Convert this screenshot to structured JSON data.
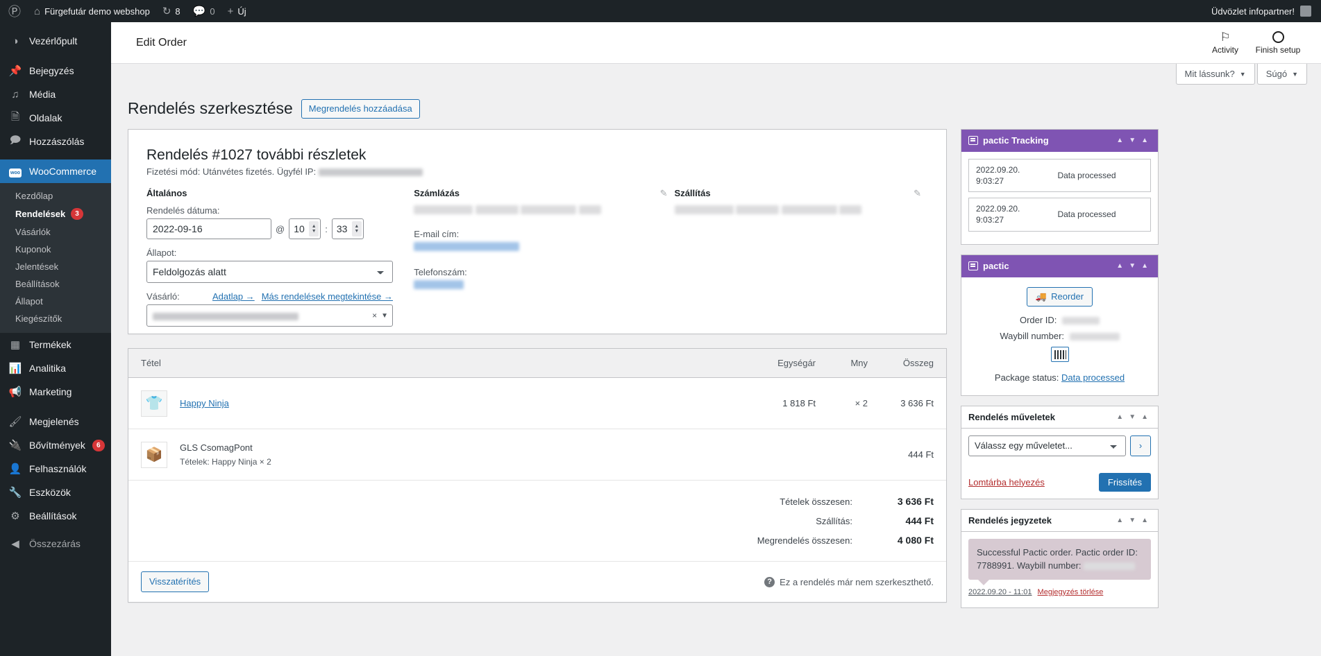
{
  "adminbar": {
    "site_title": "Fürgefutár demo webshop",
    "updates_count": "8",
    "comments_count": "0",
    "new_label": "Új",
    "greeting": "Üdvözlet infopartner!"
  },
  "sidebar": {
    "items": [
      {
        "label": "Vezérlőpult",
        "icon": "dashboard-icon"
      },
      {
        "label": "Bejegyzés",
        "icon": "pin-icon"
      },
      {
        "label": "Média",
        "icon": "media-icon"
      },
      {
        "label": "Oldalak",
        "icon": "pages-icon"
      },
      {
        "label": "Hozzászólás",
        "icon": "comment-icon"
      },
      {
        "label": "WooCommerce",
        "icon": "woocommerce-icon",
        "current": true
      },
      {
        "label": "Termékek",
        "icon": "products-icon"
      },
      {
        "label": "Analitika",
        "icon": "analytics-icon"
      },
      {
        "label": "Marketing",
        "icon": "megaphone-icon"
      },
      {
        "label": "Megjelenés",
        "icon": "appearance-icon"
      },
      {
        "label": "Bővítmények",
        "icon": "plugin-icon",
        "badge": "6"
      },
      {
        "label": "Felhasználók",
        "icon": "users-icon"
      },
      {
        "label": "Eszközök",
        "icon": "tools-icon"
      },
      {
        "label": "Beállítások",
        "icon": "settings-icon"
      },
      {
        "label": "Összezárás",
        "icon": "collapse-icon"
      }
    ],
    "submenu": [
      {
        "label": "Kezdőlap"
      },
      {
        "label": "Rendelések",
        "badge": "3",
        "active": true
      },
      {
        "label": "Vásárlók"
      },
      {
        "label": "Kuponok"
      },
      {
        "label": "Jelentések"
      },
      {
        "label": "Beállítások"
      },
      {
        "label": "Állapot"
      },
      {
        "label": "Kiegészítők"
      }
    ]
  },
  "wc_header": {
    "title": "Edit Order",
    "activity_label": "Activity",
    "finish_setup_label": "Finish setup"
  },
  "screen_meta": {
    "options_label": "Mit lássunk?",
    "help_label": "Súgó"
  },
  "page": {
    "title": "Rendelés szerkesztése",
    "add_order_label": "Megrendelés hozzáadása"
  },
  "order": {
    "heading": "Rendelés #1027 további részletek",
    "subheading": "Fizetési mód: Utánvétes fizetés. Ügyfél IP:",
    "general_title": "Általános",
    "date_label": "Rendelés dátuma:",
    "date_value": "2022-09-16",
    "time_sep": "@",
    "hour_value": "10",
    "minute_sep": ":",
    "minute_value": "33",
    "status_label": "Állapot:",
    "status_value": "Feldolgozás alatt",
    "customer_label": "Vásárló:",
    "profile_link": "Adatlap →",
    "other_orders_link": "Más rendelések megtekintése →",
    "billing_title": "Számlázás",
    "shipping_title": "Szállítás",
    "email_label": "E-mail cím:",
    "phone_label": "Telefonszám:"
  },
  "items": {
    "col_item": "Tétel",
    "col_price": "Egységár",
    "col_qty": "Mny",
    "col_total": "Összeg",
    "rows": [
      {
        "name": "Happy Ninja",
        "icon": "tshirt-icon",
        "price": "1 818 Ft",
        "qty": "× 2",
        "total": "3 636 Ft",
        "is_link": true
      },
      {
        "name": "GLS CsomagPont",
        "icon": "package-icon",
        "meta_label": "Tételek:",
        "meta_value": "Happy Ninja × 2",
        "price": "",
        "qty": "",
        "total": "444 Ft",
        "is_link": false
      }
    ],
    "totals": [
      {
        "label": "Tételek összesen:",
        "value": "3 636 Ft"
      },
      {
        "label": "Szállítás:",
        "value": "444 Ft"
      },
      {
        "label": "Megrendelés összesen:",
        "value": "4 080 Ft"
      }
    ],
    "refund_label": "Visszatérítés",
    "locked_note": "Ez a rendelés már nem szerkeszthető."
  },
  "side": {
    "tracking": {
      "title": "pactic Tracking",
      "rows": [
        {
          "date": "2022.09.20.",
          "time": "9:03:27",
          "status": "Data processed"
        },
        {
          "date": "2022.09.20.",
          "time": "9:03:27",
          "status": "Data processed"
        }
      ]
    },
    "pactic": {
      "title": "pactic",
      "reorder_label": "Reorder",
      "order_id_label": "Order ID:",
      "waybill_label": "Waybill number:",
      "package_status_label": "Package status:",
      "package_status_value": "Data processed"
    },
    "actions": {
      "title": "Rendelés műveletek",
      "select_value": "Válassz egy műveletet...",
      "go_label": "›",
      "trash_label": "Lomtárba helyezés",
      "update_label": "Frissítés"
    },
    "notes": {
      "title": "Rendelés jegyzetek",
      "note_text": "Successful Pactic order. Pactic order ID: 7788991. Waybill number:",
      "note_time": "2022.09.20 - 11:01",
      "delete_label": "Megjegyzés törlése"
    }
  },
  "colors": {
    "wp_blue": "#2271b1",
    "woo_purple": "#7f54b3",
    "admin_dark": "#1d2327",
    "danger": "#d63638"
  }
}
